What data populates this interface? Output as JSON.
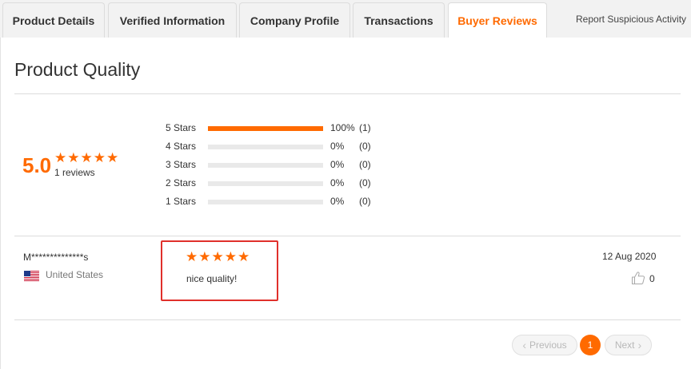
{
  "tabs": [
    {
      "label": "Product Details"
    },
    {
      "label": "Verified Information"
    },
    {
      "label": "Company Profile"
    },
    {
      "label": "Transactions"
    },
    {
      "label": "Buyer Reviews",
      "active": true
    }
  ],
  "report_link": "Report Suspicious Activity",
  "section_title": "Product Quality",
  "summary": {
    "score": "5.0",
    "stars": 5,
    "reviews_text": "1 reviews"
  },
  "distribution": [
    {
      "label": "5 Stars",
      "fraction": 1.0,
      "pct": "100%",
      "count": "(1)"
    },
    {
      "label": "4 Stars",
      "fraction": 0.0,
      "pct": "0%",
      "count": "(0)"
    },
    {
      "label": "3 Stars",
      "fraction": 0.0,
      "pct": "0%",
      "count": "(0)"
    },
    {
      "label": "2 Stars",
      "fraction": 0.0,
      "pct": "0%",
      "count": "(0)"
    },
    {
      "label": "1 Stars",
      "fraction": 0.0,
      "pct": "0%",
      "count": "(0)"
    }
  ],
  "review": {
    "reviewer": "M**************s",
    "country": "United States",
    "flag_icon": "us-flag-icon",
    "rating": 5,
    "text": "nice quality!",
    "date": "12 Aug 2020",
    "likes": "0"
  },
  "pagination": {
    "previous": "Previous",
    "current": "1",
    "next": "Next"
  },
  "colors": {
    "accent": "#ff6a00",
    "highlight_border": "#e0302b"
  }
}
